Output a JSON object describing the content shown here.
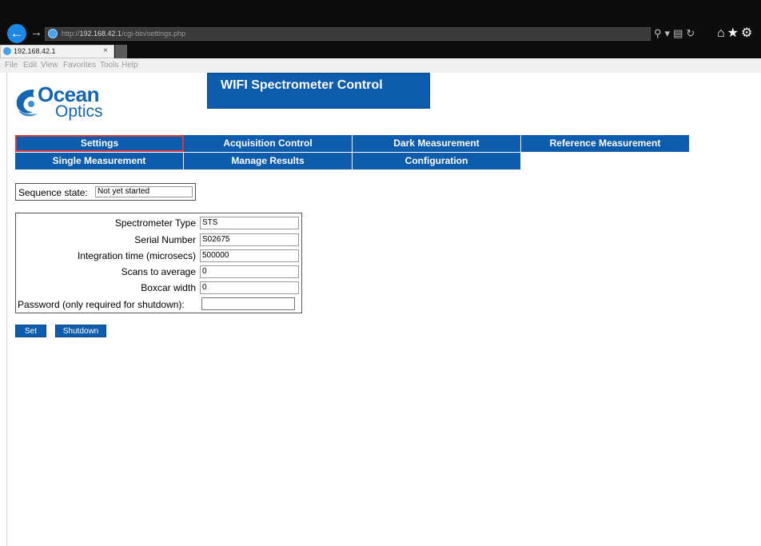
{
  "browser": {
    "url_prefix": "http://",
    "url_host": "192.168.42.1",
    "url_path": "/cgi-bin/settings.php",
    "tab_title": "192.168.42.1",
    "tab_close": "×",
    "menu": [
      "File",
      "Edit",
      "View",
      "Favorites",
      "Tools",
      "Help"
    ]
  },
  "logo": {
    "line1": "Ocean",
    "line2": "Optics"
  },
  "page_title": "WIFI Spectrometer Control",
  "nav": {
    "settings": "Settings",
    "acquisition_control": "Acquisition Control",
    "dark_measurement": "Dark Measurement",
    "reference_measurement": "Reference Measurement",
    "single_measurement": "Single Measurement",
    "manage_results": "Manage Results",
    "configuration": "Configuration"
  },
  "sequence": {
    "label": "Sequence state:",
    "value": "Not yet started"
  },
  "form": {
    "spectrometer_type_label": "Spectrometer Type",
    "spectrometer_type_value": "STS",
    "serial_number_label": "Serial Number",
    "serial_number_value": "S02675",
    "integration_time_label": "Integration time (microsecs)",
    "integration_time_value": "500000",
    "scans_to_average_label": "Scans to average",
    "scans_to_average_value": "0",
    "boxcar_width_label": "Boxcar width",
    "boxcar_width_value": "0",
    "password_label": "Password (only required for shutdown):"
  },
  "buttons": {
    "set": "Set",
    "shutdown": "Shutdown"
  },
  "colors": {
    "nav_blue": "#0d5cad",
    "active_border": "#d93a3a",
    "logo_blue": "#1565b2"
  }
}
